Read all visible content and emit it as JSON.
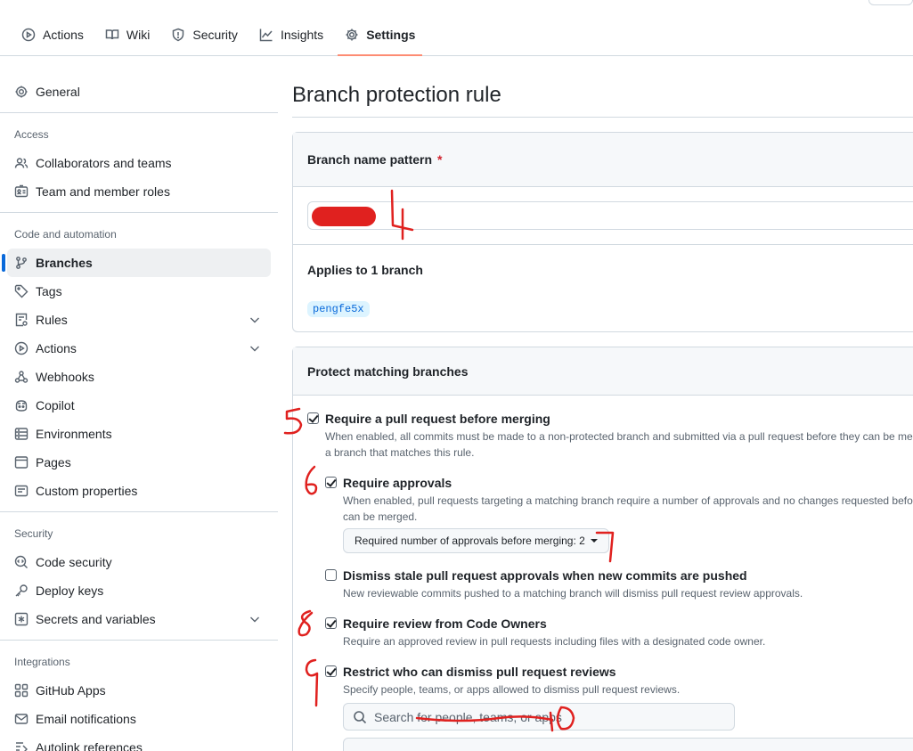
{
  "topnav": {
    "tabs": [
      {
        "label": "Actions",
        "icon": "play-icon"
      },
      {
        "label": "Wiki",
        "icon": "book-icon"
      },
      {
        "label": "Security",
        "icon": "shield-icon"
      },
      {
        "label": "Insights",
        "icon": "graph-icon"
      },
      {
        "label": "Settings",
        "icon": "gear-icon",
        "active": true
      }
    ]
  },
  "sidebar": {
    "general": "General",
    "access_heading": "Access",
    "collaborators": "Collaborators and teams",
    "team_roles": "Team and member roles",
    "code_heading": "Code and automation",
    "branches": "Branches",
    "tags": "Tags",
    "rules": "Rules",
    "actions": "Actions",
    "webhooks": "Webhooks",
    "copilot": "Copilot",
    "environments": "Environments",
    "pages": "Pages",
    "custom_properties": "Custom properties",
    "security_heading": "Security",
    "code_security": "Code security",
    "deploy_keys": "Deploy keys",
    "secrets": "Secrets and variables",
    "integrations_heading": "Integrations",
    "github_apps": "GitHub Apps",
    "email_notifications": "Email notifications",
    "autolink": "Autolink references"
  },
  "main": {
    "title": "Branch protection rule",
    "pattern_label": "Branch name pattern",
    "required_star": "*",
    "applies": "Applies to 1 branch",
    "branch_chip": "pengfe5x",
    "protect_heading": "Protect matching branches",
    "options": {
      "require_pr": {
        "label": "Require a pull request before merging",
        "desc1": "When enabled, all commits must be made to a non-protected branch and submitted via a pull request before they can be me",
        "desc2": "a branch that matches this rule.",
        "checked": true
      },
      "require_approvals": {
        "label": "Require approvals",
        "desc1": "When enabled, pull requests targeting a matching branch require a number of approvals and no changes requested befor",
        "desc2": "can be merged.",
        "checked": true
      },
      "approvals_select": "Required number of approvals before merging: 2",
      "dismiss_stale": {
        "label": "Dismiss stale pull request approvals when new commits are pushed",
        "desc": "New reviewable commits pushed to a matching branch will dismiss pull request review approvals.",
        "checked": false
      },
      "code_owners": {
        "label": "Require review from Code Owners",
        "desc": "Require an approved review in pull requests including files with a designated code owner.",
        "checked": true
      },
      "restrict_dismiss": {
        "label": "Restrict who can dismiss pull request reviews",
        "desc": "Specify people, teams, or apps allowed to dismiss pull request reviews.",
        "checked": true
      },
      "search_placeholder": "Search for people, teams, or apps"
    }
  },
  "annotations": {
    "n4": "4",
    "n5": "5",
    "n6": "6",
    "n7": "7",
    "n8": "8",
    "n9": "9",
    "n10": "10"
  },
  "colors": {
    "accent": "#0969da",
    "tab_underline": "#fd8c73",
    "annotation_red": "#e0211f",
    "required": "#d1242f"
  }
}
